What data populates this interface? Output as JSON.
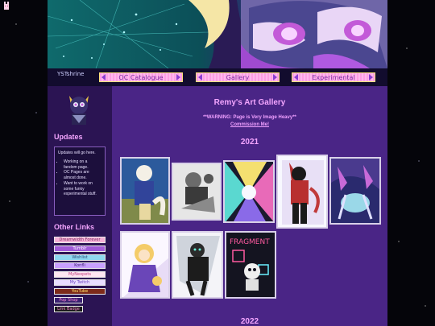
{
  "corner_icon": "bunny-icon",
  "banner": {
    "alt": "banner artwork"
  },
  "nav": {
    "logo_alt": "YSTshrine",
    "buttons": [
      "OC Catalogue",
      "Gallery",
      "Experimental"
    ]
  },
  "sidebar": {
    "updates_title": "Updates",
    "updates_intro": "Updates will go here.",
    "updates_items": [
      "Working on a fandom page.",
      "OC Pages are almost done.",
      "Want to work on some funky experimental stuff."
    ],
    "links_title": "Other Links",
    "links": [
      "Dreamwidth Forever",
      "Tumblr",
      "Wishlist",
      "Konfli",
      "MyNeopets",
      "My Twitch",
      "YouTube",
      "Pop Shop",
      "Link Badge"
    ]
  },
  "main": {
    "title": "Remy's Art Gallery",
    "warning": "**WARNING: Page is Very Image Heavy**",
    "commission": "Commission Me!",
    "years": [
      "2021",
      "2022"
    ]
  },
  "colors": {
    "accent": "#f4a6ff",
    "page_bg": "#4a2586",
    "sidebar_bg": "#2b1453",
    "nav_button": "#ff9de4"
  }
}
